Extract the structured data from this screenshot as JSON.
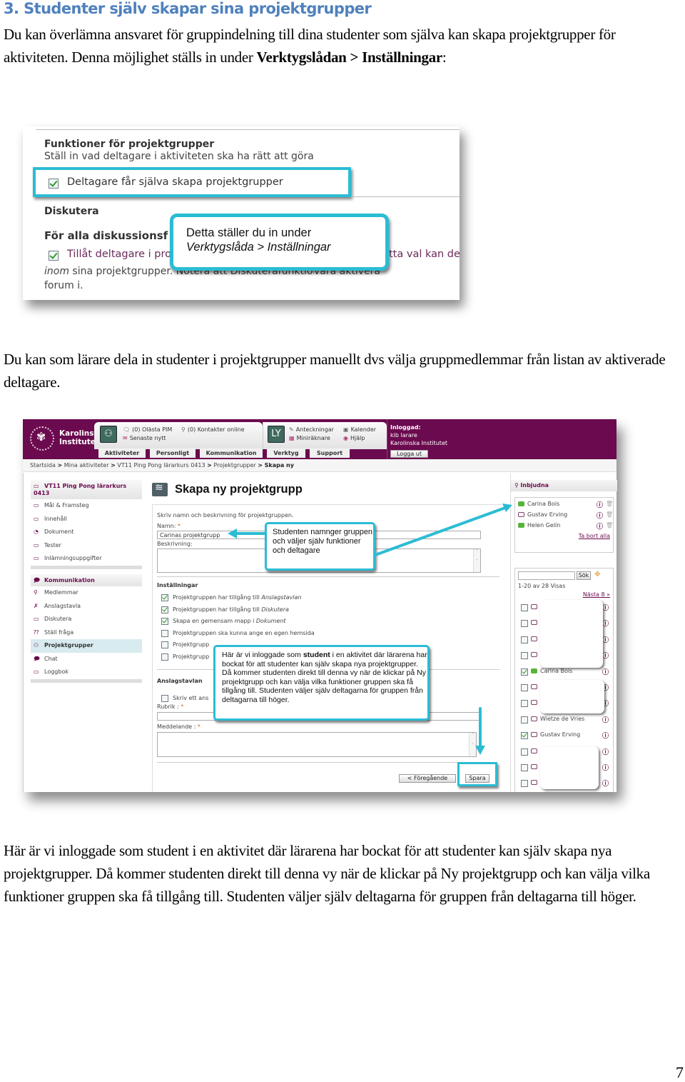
{
  "heading": "3. Studenter själv skapar sina projektgrupper",
  "intro": {
    "text": "Du kan överlämna ansvaret för gruppindelning till dina studenter som själva kan skapa projektgrupper för aktiviteten. Denna möjlighet ställs in under ",
    "bold": "Verktygslådan > Inställningar",
    "tail": ":"
  },
  "screenshot1": {
    "section_title": "Funktioner för projektgrupper",
    "section_subtitle": "Ställ in vad deltagare i aktiviteten ska ha rätt att göra",
    "checkbox_label": "Deltagare får själva skapa projektgrupper",
    "checkbox_checked": true,
    "discuss_title": "Diskutera",
    "forums_title": "För alla diskussionsf",
    "allow_label": "Tillåt deltagare i pro",
    "allow_label_tail": "tta val kan de",
    "allow_checked": true,
    "desc_italic": "inom",
    "desc_line": " sina projektgrupper. Notera att Diskuterafunktionen måste",
    "desc_line_tail": "vara aktivera",
    "desc_line2": "forum i.",
    "callout_line1": "Detta ställer du in under",
    "callout_line2": "Verktygslåda > Inställningar",
    "accent_color": "#2bbcd4"
  },
  "mid_text": "Du kan som lärare dela in studenter i projektgrupper manuellt dvs välja gruppmedlemmar från listan av aktiverade deltagare.",
  "screenshot2": {
    "brand_color": "#6b0a4e",
    "logo_line1": "Karolinska",
    "logo_line2": "Institutet",
    "tools": {
      "unread_pim": "(0) Olästa PIM",
      "contacts_online": "(0) Kontakter online",
      "news": "Senaste nytt",
      "notes": "Anteckningar",
      "calculator": "Miniräknare",
      "calendar": "Kalender",
      "help": "Hjälp"
    },
    "nav_tabs": [
      "Aktiviteter",
      "Personligt",
      "Kommunikation",
      "Verktyg",
      "Support"
    ],
    "login": {
      "label": "Inloggad:",
      "user": "kib larare",
      "org": "Karolinska Institutet",
      "logout": "Logga ut"
    },
    "breadcrumb": {
      "items": [
        "Startsida",
        "Mina aktiviteter",
        "VT11 Ping Pong lärarkurs 0413",
        "Projektgrupper"
      ],
      "current": "Skapa ny",
      "separator": ">"
    },
    "sidebar": {
      "course_title": "VT11 Ping Pong lärarkurs 0413",
      "course_items": [
        "Mål & Framsteg",
        "Innehåll",
        "Dokument",
        "Tester",
        "Inlämningsuppgifter"
      ],
      "comm_title": "Kommunikation",
      "comm_items": [
        "Medlemmar",
        "Anslagstavla",
        "Diskutera",
        "Ställ fråga",
        "Projektgrupper",
        "Chat",
        "Loggbok"
      ],
      "active_item": "Projektgrupper"
    },
    "form": {
      "title": "Skapa ny projektgrupp",
      "intro": "Skriv namn och beskrivning för projektgruppen.",
      "name_label": "Namn:",
      "required_mark": "*",
      "name_value": "Carinas projektgrupp",
      "desc_label": "Beskrivning:",
      "settings_title": "Inställningar",
      "settings": [
        {
          "pre": "Projektgruppen har tillgång till ",
          "em": "Anslagstavlan",
          "checked": true
        },
        {
          "pre": "Projektgruppen har tillgång till ",
          "em": "Diskutera",
          "checked": true
        },
        {
          "pre": "Skapa en gemensam mapp i ",
          "em": "Dokument",
          "checked": true
        },
        {
          "pre": "Projektgruppen ska kunna ange en egen hemsida",
          "em": "",
          "checked": false
        },
        {
          "pre": "Projektgrupp",
          "em": "",
          "checked": false
        },
        {
          "pre": "Projektgrupp",
          "em": "",
          "checked": false
        }
      ],
      "board_title": "Anslagstavlan",
      "board_checkbox": "Skriv ett ans",
      "board_checked": false,
      "subject_label": "Rubrik :",
      "message_label": "Meddelande :",
      "prev_button": "< Föregående",
      "save_button": "Spara"
    },
    "callout_name": "Studenten namnger gruppen och väljer själv funktioner och deltagare",
    "callout_student_pre": "Här är vi inloggade som ",
    "callout_student_bold": "student",
    "callout_student_post": " i en aktivitet där lärarena har bockat för att studenter kan själv skapa nya projektgrupper. Då kommer studenten direkt till denna vy när de klickar på Ny projektgrupp och kan välja vilka funktioner gruppen ska få tillgång till. Studenten väljer själv deltagarna för gruppen från deltagarna till höger.",
    "invited": {
      "title": "Inbjudna",
      "members": [
        {
          "name": "Carina Bois",
          "online": true
        },
        {
          "name": "Gustav Erving",
          "online": false
        },
        {
          "name": "Helen Gelin",
          "online": true
        }
      ],
      "remove_all": "Ta bort alla"
    },
    "search": {
      "value": "",
      "button": "Sök",
      "count": "1-20 av 28 Visas",
      "next": "Nästa 8 »"
    },
    "participants": [
      {
        "name": "",
        "checked": false
      },
      {
        "name": "",
        "checked": false
      },
      {
        "name": "",
        "checked": false
      },
      {
        "name": "",
        "checked": false
      },
      {
        "name": "Carina Bois",
        "checked": true
      },
      {
        "name": "",
        "checked": false
      },
      {
        "name": "",
        "checked": false
      },
      {
        "name": "Wietze de Vries",
        "checked": false
      },
      {
        "name": "Gustav Erving",
        "checked": true
      },
      {
        "name": "",
        "checked": false
      },
      {
        "name": "",
        "checked": false
      },
      {
        "name": "",
        "checked": false
      }
    ]
  },
  "closing_text": "Här är vi inloggade som student i en aktivitet där lärarena har bockat för att studenter kan själv skapa nya projektgrupper. Då kommer studenten direkt till denna vy när de klickar på Ny projektgrupp och kan välja vilka funktioner gruppen ska få tillgång till. Studenten väljer själv deltagarna för gruppen från deltagarna till höger.",
  "page_number": "7"
}
